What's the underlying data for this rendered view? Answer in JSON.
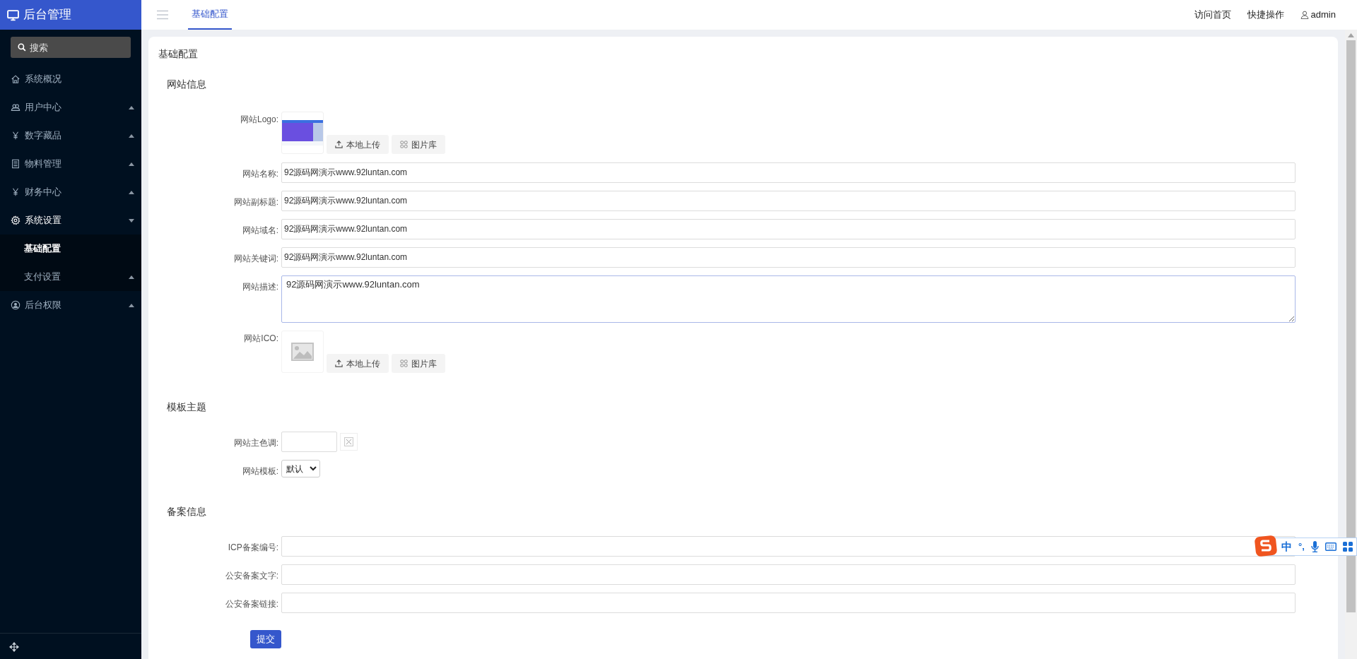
{
  "sidebar": {
    "title": "后台管理",
    "search": {
      "placeholder": "搜索"
    },
    "items": [
      {
        "label": "系统概况",
        "selected": false
      },
      {
        "label": "用户中心",
        "expanded": false,
        "selected": false
      },
      {
        "label": "数字藏品",
        "expanded": false,
        "selected": false
      },
      {
        "label": "物料管理",
        "expanded": false,
        "selected": false
      },
      {
        "label": "财务中心",
        "expanded": false,
        "selected": false
      },
      {
        "label": "系统设置",
        "expanded": true,
        "selected": false,
        "children": [
          {
            "label": "基础配置",
            "selected": true
          },
          {
            "label": "支付设置",
            "selected": false,
            "expanded": false
          }
        ]
      },
      {
        "label": "后台权限",
        "expanded": false,
        "selected": false
      }
    ]
  },
  "header": {
    "tabs": [
      {
        "label": "基础配置",
        "selected": true
      }
    ],
    "links": [
      {
        "kind": "link",
        "label": "访问首页"
      },
      {
        "kind": "link",
        "label": "快捷操作"
      },
      {
        "kind": "account",
        "label": "admin"
      }
    ]
  },
  "card": {
    "title": "基础配置",
    "sections": [
      {
        "title": "网站信息",
        "fields": [
          {
            "kind": "image",
            "label": "网站Logo:",
            "has_image": true,
            "buttons": [
              "本地上传",
              "图片库"
            ]
          },
          {
            "kind": "text",
            "label": "网站名称:",
            "value": "92源码网演示www.92luntan.com"
          },
          {
            "kind": "text",
            "label": "网站副标题:",
            "value": "92源码网演示www.92luntan.com"
          },
          {
            "kind": "text",
            "label": "网站域名:",
            "value": "92源码网演示www.92luntan.com"
          },
          {
            "kind": "text",
            "label": "网站关键词:",
            "value": "92源码网演示www.92luntan.com"
          },
          {
            "kind": "textarea",
            "label": "网站描述:",
            "value": "92源码网演示www.92luntan.com"
          },
          {
            "kind": "image",
            "label": "网站ICO:",
            "has_image": false,
            "buttons": [
              "本地上传",
              "图片库"
            ]
          }
        ]
      },
      {
        "title": "模板主题",
        "fields": [
          {
            "kind": "color",
            "label": "网站主色调:"
          },
          {
            "kind": "select",
            "label": "网站模板:",
            "value": "默认"
          }
        ]
      },
      {
        "title": "备案信息",
        "fields": [
          {
            "kind": "text",
            "label": "ICP备案编号:"
          },
          {
            "kind": "text",
            "label": "公安备案文字:"
          },
          {
            "kind": "text",
            "label": "公安备案链接:"
          }
        ]
      }
    ],
    "submit": "提交"
  },
  "ime_toolbar": {
    "mode": "中",
    "punct": "°,"
  }
}
